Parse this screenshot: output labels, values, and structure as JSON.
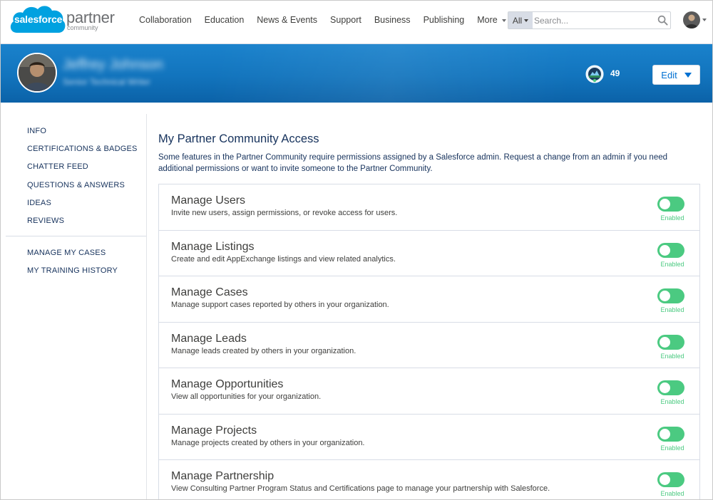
{
  "brand": {
    "cloud_text": "salesforce",
    "wordmark": "partner",
    "subtext": "community",
    "cloud_color": "#00a1e0"
  },
  "nav": {
    "items": [
      {
        "label": "Collaboration"
      },
      {
        "label": "Education"
      },
      {
        "label": "News & Events"
      },
      {
        "label": "Support"
      },
      {
        "label": "Business"
      },
      {
        "label": "Publishing"
      },
      {
        "label": "More"
      }
    ],
    "search": {
      "scope": "All",
      "placeholder": "Search..."
    }
  },
  "profile": {
    "name": "Jeffrey Johnson",
    "title": "Senior Technical Writer",
    "points": "49",
    "edit_label": "Edit"
  },
  "sidebar": {
    "primary": [
      {
        "label": "INFO"
      },
      {
        "label": "CERTIFICATIONS & BADGES"
      },
      {
        "label": "CHATTER FEED"
      },
      {
        "label": "QUESTIONS & ANSWERS"
      },
      {
        "label": "IDEAS"
      },
      {
        "label": "REVIEWS"
      }
    ],
    "secondary": [
      {
        "label": "MANAGE MY CASES"
      },
      {
        "label": "MY TRAINING HISTORY"
      }
    ]
  },
  "main": {
    "title": "My Partner Community Access",
    "description": "Some features in the Partner Community require permissions assigned by a Salesforce admin. Request a change from an admin if you need additional permissions or want to invite someone to the Partner Community.",
    "permissions": [
      {
        "title": "Manage Users",
        "desc": "Invite new users, assign permissions, or revoke access for users.",
        "status": "Enabled"
      },
      {
        "title": "Manage Listings",
        "desc": "Create and edit AppExchange listings and view related analytics.",
        "status": "Enabled"
      },
      {
        "title": "Manage Cases",
        "desc": "Manage support cases reported by others in your organization.",
        "status": "Enabled"
      },
      {
        "title": "Manage Leads",
        "desc": "Manage leads created by others in your organization.",
        "status": "Enabled"
      },
      {
        "title": "Manage Opportunities",
        "desc": "View all opportunities for your organization.",
        "status": "Enabled"
      },
      {
        "title": "Manage Projects",
        "desc": "Manage projects created by others in your organization.",
        "status": "Enabled"
      },
      {
        "title": "Manage Partnership",
        "desc": "View Consulting Partner Program Status and Certifications page to manage your partnership with Salesforce.",
        "status": "Enabled"
      }
    ]
  },
  "colors": {
    "banner": "#1274bd",
    "toggle_on": "#4bca81",
    "link": "#0070d2",
    "text": "#16325c"
  },
  "icons": {
    "search": "search-icon",
    "badge": "trailhead-badge-icon",
    "caret": "caret-down-icon"
  }
}
